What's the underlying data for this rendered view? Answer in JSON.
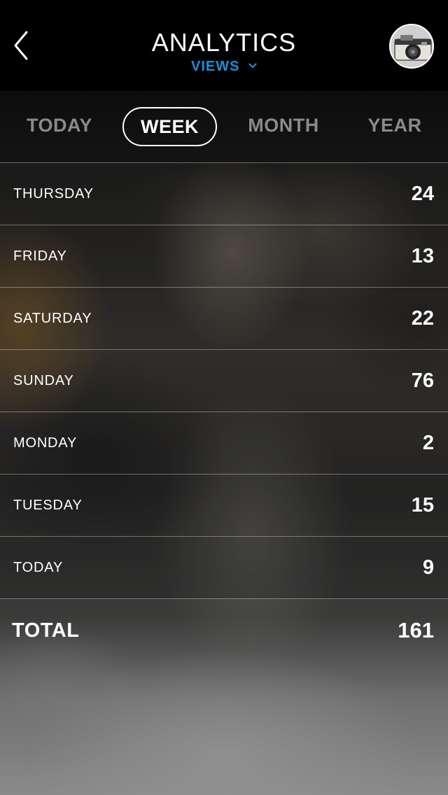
{
  "header": {
    "title": "ANALYTICS",
    "dropdown_label": "VIEWS"
  },
  "tabs": [
    {
      "label": "TODAY",
      "active": false
    },
    {
      "label": "WEEK",
      "active": true
    },
    {
      "label": "MONTH",
      "active": false
    },
    {
      "label": "YEAR",
      "active": false
    }
  ],
  "rows": [
    {
      "label": "THURSDAY",
      "value": "24"
    },
    {
      "label": "FRIDAY",
      "value": "13"
    },
    {
      "label": "SATURDAY",
      "value": "22"
    },
    {
      "label": "SUNDAY",
      "value": "76"
    },
    {
      "label": "MONDAY",
      "value": "2"
    },
    {
      "label": "TUESDAY",
      "value": "15"
    },
    {
      "label": "TODAY",
      "value": "9"
    }
  ],
  "total": {
    "label": "TOTAL",
    "value": "161"
  },
  "colors": {
    "accent": "#1e8fd6",
    "header_bg": "#000000",
    "inactive_tab": "#8a8a8a"
  },
  "icons": {
    "back": "chevron-left-icon",
    "dropdown": "chevron-down-icon",
    "avatar": "camera-avatar"
  }
}
